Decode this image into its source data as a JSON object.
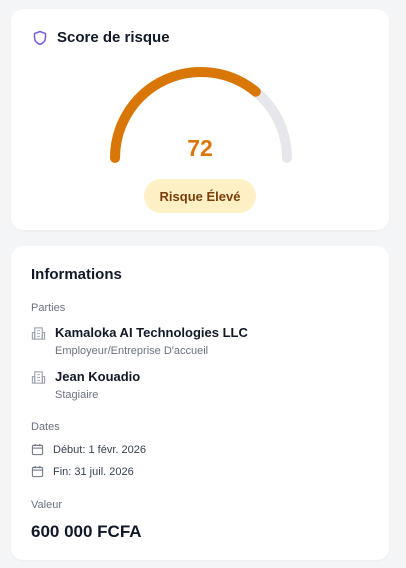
{
  "risk": {
    "title": "Score de risque",
    "score": 72,
    "score_text": "72",
    "level_label": "Risque Élevé",
    "colors": {
      "gauge_fill": "#d97706",
      "gauge_track": "#e5e7eb",
      "badge_bg": "#fdf0c5",
      "badge_text": "#7c3d0a",
      "shield": "#7c5cdb"
    }
  },
  "info": {
    "title": "Informations",
    "parties_label": "Parties",
    "parties": [
      {
        "name": "Kamaloka AI Technologies LLC",
        "role": "Employeur/Entreprise D'accueil",
        "icon": "building-icon"
      },
      {
        "name": "Jean Kouadio",
        "role": "Stagiaire",
        "icon": "building-icon"
      }
    ],
    "dates_label": "Dates",
    "dates": [
      {
        "text": "Début: 1 févr. 2026",
        "icon": "calendar-icon"
      },
      {
        "text": "Fin: 31 juil. 2026",
        "icon": "calendar-icon"
      }
    ],
    "value_label": "Valeur",
    "value": "600 000 FCFA"
  }
}
